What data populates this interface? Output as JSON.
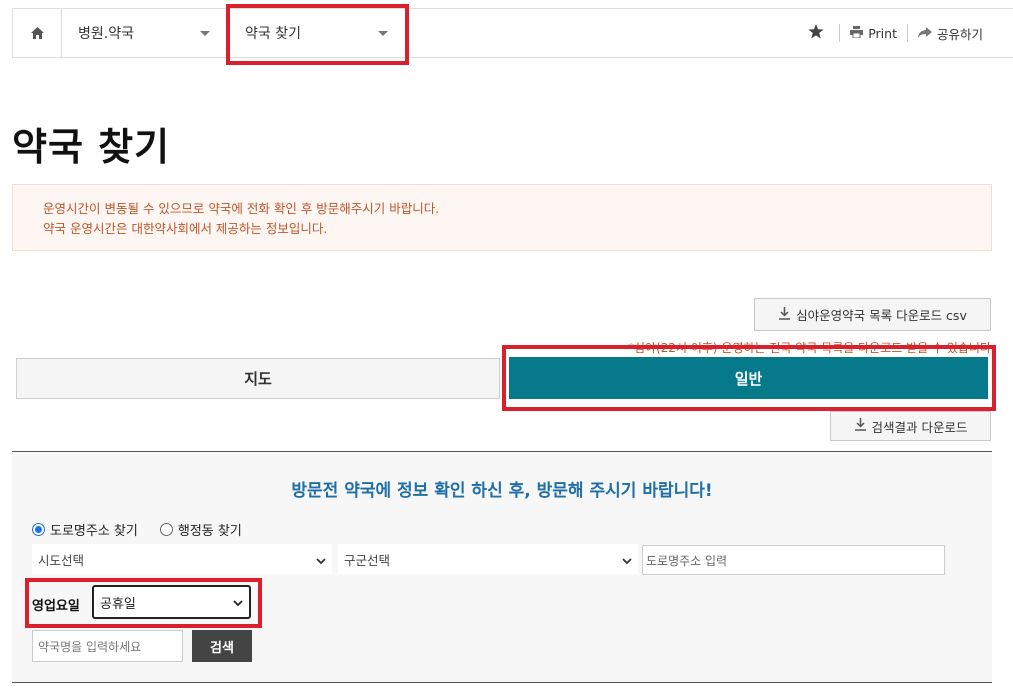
{
  "breadcrumb": {
    "home_icon": "home-icon",
    "level1": "병원.약국",
    "level2": "약국 찾기"
  },
  "tools": {
    "favorite_icon": "star-icon",
    "print_label": "Print",
    "share_label": "공유하기"
  },
  "page": {
    "title": "약국 찾기"
  },
  "notice": {
    "line1": "운영시간이 변동될 수 있으므로 약국에 전화 확인 후 방문해주시기 바랍니다.",
    "line2": "약국 운영시간은 대한약사회에서 제공하는 정보입니다."
  },
  "downloads": {
    "csv_label": "심야운영약국 목록 다운로드 csv",
    "csv_note": "*심야(22시 이후) 운영하는 전국 약국 목록을 다운로드 받을 수 있습니다",
    "result_label": "검색결과 다운로드"
  },
  "tabs": [
    {
      "label": "지도",
      "active": false
    },
    {
      "label": "일반",
      "active": true
    }
  ],
  "search": {
    "heading": "방문전 약국에 정보 확인 하신 후, 방문해 주시기 바랍니다!",
    "radio_road": "도로명주소 찾기",
    "radio_admin": "행정동 찾기",
    "sido_selected": "시도선택",
    "gugun_selected": "구군선택",
    "road_placeholder": "도로명주소 입력",
    "day_label": "영업요일",
    "day_selected": "공휴일",
    "name_placeholder": "약국명을 입력하세요",
    "submit_label": "검색"
  },
  "colors": {
    "accent_teal": "#067a8b",
    "notice_text": "#c0562a",
    "heading_blue": "#1e6fa8",
    "highlight_red": "#d9202c"
  }
}
